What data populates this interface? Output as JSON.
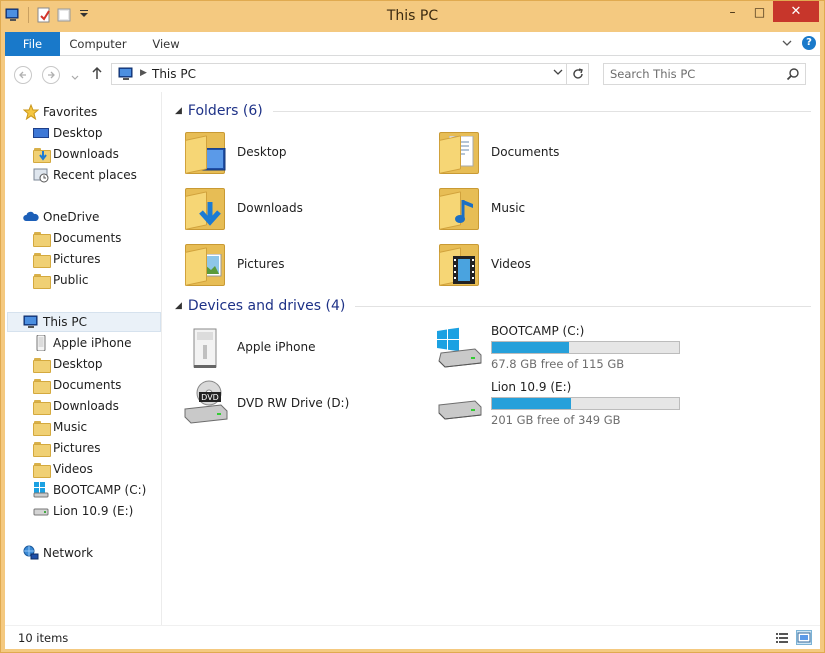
{
  "window": {
    "title": "This PC",
    "buttons": {
      "minimize": "–",
      "maximize": "□",
      "close": "✕"
    }
  },
  "ribbon": {
    "tabs": [
      {
        "label": "File"
      },
      {
        "label": "Computer"
      },
      {
        "label": "View"
      }
    ],
    "help": "?"
  },
  "address": {
    "crumb": "This PC",
    "search_placeholder": "Search This PC"
  },
  "navpane": {
    "favorites": {
      "label": "Favorites",
      "items": [
        {
          "label": "Desktop",
          "icon": "desktop-icon"
        },
        {
          "label": "Downloads",
          "icon": "downloads-folder-icon"
        },
        {
          "label": "Recent places",
          "icon": "recent-places-icon"
        }
      ]
    },
    "onedrive": {
      "label": "OneDrive",
      "items": [
        {
          "label": "Documents"
        },
        {
          "label": "Pictures"
        },
        {
          "label": "Public"
        }
      ]
    },
    "thispc": {
      "label": "This PC",
      "items": [
        {
          "label": "Apple iPhone",
          "icon": "phone-icon"
        },
        {
          "label": "Desktop",
          "icon": "folder-icon"
        },
        {
          "label": "Documents",
          "icon": "folder-icon"
        },
        {
          "label": "Downloads",
          "icon": "folder-icon"
        },
        {
          "label": "Music",
          "icon": "folder-icon"
        },
        {
          "label": "Pictures",
          "icon": "folder-icon"
        },
        {
          "label": "Videos",
          "icon": "folder-icon"
        },
        {
          "label": "BOOTCAMP (C:)",
          "icon": "windows-drive-icon"
        },
        {
          "label": "Lion 10.9 (E:)",
          "icon": "drive-icon"
        }
      ]
    },
    "network": {
      "label": "Network"
    }
  },
  "content": {
    "folders_header": "Folders (6)",
    "folders": [
      {
        "label": "Desktop"
      },
      {
        "label": "Documents"
      },
      {
        "label": "Downloads"
      },
      {
        "label": "Music"
      },
      {
        "label": "Pictures"
      },
      {
        "label": "Videos"
      }
    ],
    "devices_header": "Devices and drives (4)",
    "devices": [
      {
        "label": "Apple iPhone"
      },
      {
        "label": "DVD RW Drive (D:)"
      }
    ],
    "drives": [
      {
        "label": "BOOTCAMP (C:)",
        "free": "67.8 GB free of 115 GB",
        "used_fraction": 0.41
      },
      {
        "label": "Lion 10.9 (E:)",
        "free": "201 GB free of 349 GB",
        "used_fraction": 0.42
      }
    ]
  },
  "status": {
    "count": "10 items"
  },
  "colors": {
    "accent": "#1979ca",
    "drive_bar": "#26a0da",
    "frame": "#f4c980",
    "header_text": "#1e3287"
  }
}
